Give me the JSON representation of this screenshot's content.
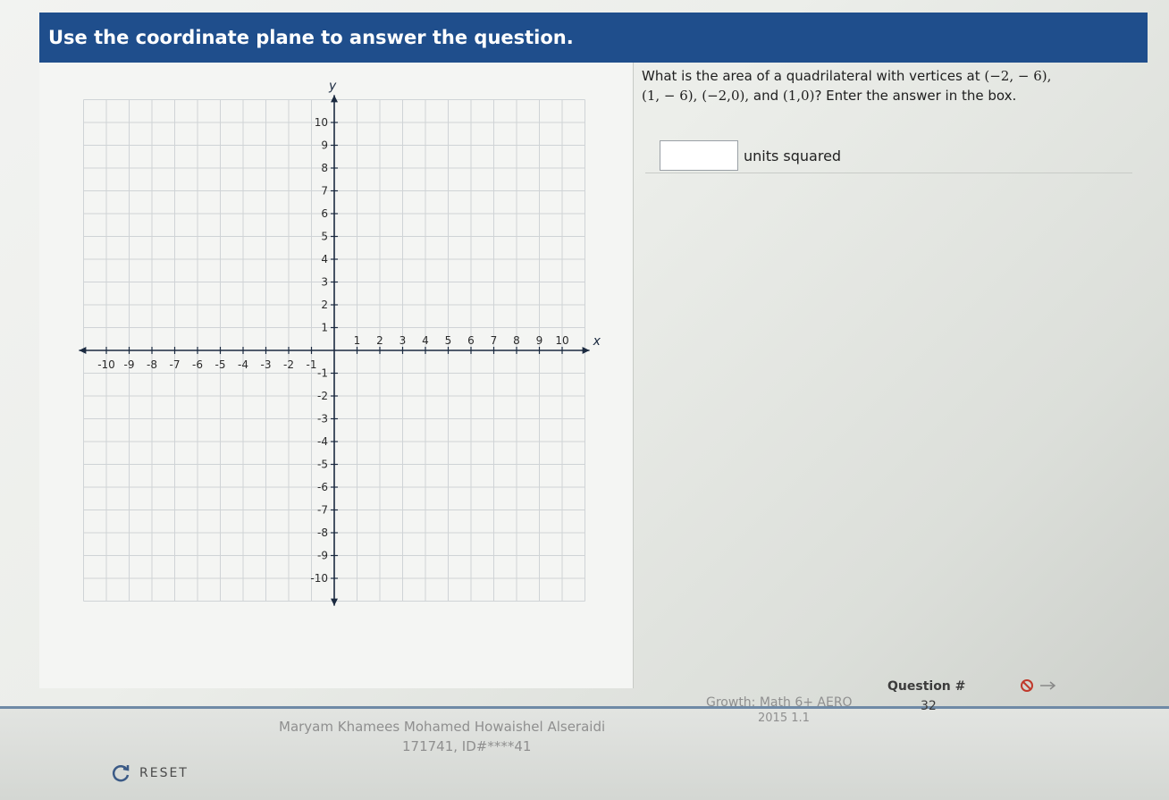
{
  "header": {
    "title": "Use the coordinate plane to answer the question."
  },
  "graph": {
    "x_axis_label": "x",
    "y_axis_label": "y",
    "x_ticks": [
      "-10",
      "-9",
      "-8",
      "-7",
      "-6",
      "-5",
      "-4",
      "-3",
      "-2",
      "-1",
      "1",
      "2",
      "3",
      "4",
      "5",
      "6",
      "7",
      "8",
      "9",
      "10"
    ],
    "y_ticks": [
      "10",
      "9",
      "8",
      "7",
      "6",
      "5",
      "4",
      "3",
      "2",
      "1",
      "-1",
      "-2",
      "-3",
      "-4",
      "-5",
      "-6",
      "-7",
      "-8",
      "-9",
      "-10"
    ]
  },
  "question": {
    "text_part1": "What is the area of a quadrilateral with vertices at ",
    "vertex1": "(−2, − 6),",
    "vertex2": "(1, − 6),",
    "vertex3": "(−2,0),",
    "and_word": " and ",
    "vertex4": "(1,0)",
    "text_part2": "? Enter the answer in the box.",
    "answer_value": "",
    "units": "units squared"
  },
  "footer": {
    "reset_label": "RESET",
    "student_name": "Maryam Khamees Mohamed Howaishel Alseraidi",
    "student_id": "171741, ID#****41",
    "test_name": "Growth: Math 6+ AERO",
    "test_version": "2015 1.1",
    "question_label": "Question #",
    "question_number": "32"
  },
  "colors": {
    "header_bg": "#1f4e8c",
    "grid": "#cfd3d6",
    "axis": "#1b2a40"
  },
  "icons": {
    "reset": "refresh-icon",
    "flag": "flag-icon",
    "next": "arrow-right-icon"
  }
}
